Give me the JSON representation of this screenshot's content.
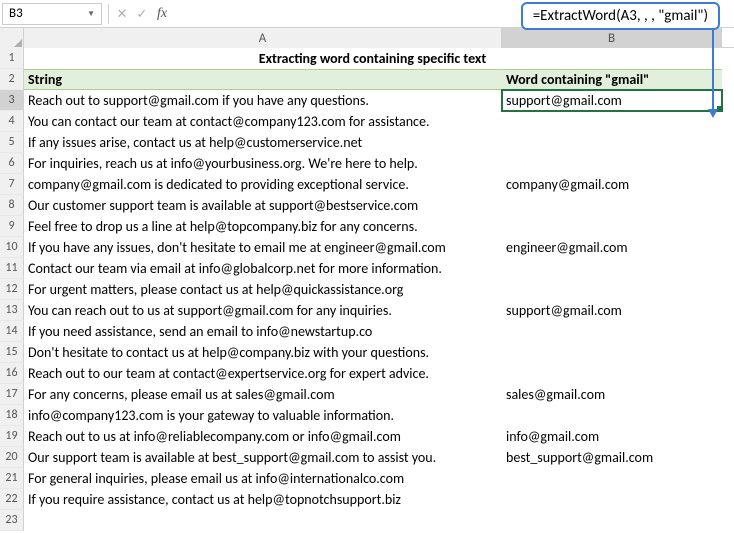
{
  "nameBox": {
    "value": "B3"
  },
  "formulaBar": {
    "cancelGlyph": "✕",
    "enterGlyph": "✓",
    "fxLabel": "fx",
    "value": ""
  },
  "callout": {
    "text": "=ExtractWord(A3, , , \"gmail\")"
  },
  "columns": {
    "A": "A",
    "B": "B"
  },
  "rowNumbers": [
    "1",
    "2",
    "3",
    "4",
    "5",
    "6",
    "7",
    "8",
    "9",
    "10",
    "11",
    "12",
    "13",
    "14",
    "15",
    "16",
    "17",
    "18",
    "19",
    "20",
    "21",
    "22",
    "23"
  ],
  "title": "Extracting word containing specific text",
  "headers": {
    "A": "String",
    "B": "Word containing \"gmail\""
  },
  "activeCell": "B3",
  "rows": [
    {
      "a": "Reach out to support@gmail.com if you have any questions.",
      "b": "support@gmail.com"
    },
    {
      "a": "You can contact our team at contact@company123.com for assistance.",
      "b": ""
    },
    {
      "a": "If any issues arise, contact us at help@customerservice.net",
      "b": ""
    },
    {
      "a": "For inquiries, reach us at info@yourbusiness.org. We're here to help.",
      "b": ""
    },
    {
      "a": "company@gmail.com is dedicated to providing exceptional service.",
      "b": "company@gmail.com"
    },
    {
      "a": "Our customer support team is available at support@bestservice.com",
      "b": ""
    },
    {
      "a": "Feel free to drop us a line at help@topcompany.biz for any concerns.",
      "b": ""
    },
    {
      "a": "If you have any issues, don't hesitate to email me at engineer@gmail.com",
      "b": "engineer@gmail.com"
    },
    {
      "a": "Contact our team via email at info@globalcorp.net for more information.",
      "b": ""
    },
    {
      "a": "For urgent matters, please contact us at help@quickassistance.org",
      "b": ""
    },
    {
      "a": "You can reach out to us at support@gmail.com for any inquiries.",
      "b": "support@gmail.com"
    },
    {
      "a": "If you need assistance, send an email to info@newstartup.co",
      "b": ""
    },
    {
      "a": "Don't hesitate to contact us at help@company.biz with your questions.",
      "b": ""
    },
    {
      "a": "Reach out to our team at contact@expertservice.org for expert advice.",
      "b": ""
    },
    {
      "a": "For any concerns, please email us at sales@gmail.com",
      "b": "sales@gmail.com"
    },
    {
      "a": "info@company123.com is your gateway to valuable information.",
      "b": ""
    },
    {
      "a": "Reach out to us at info@reliablecompany.com or info@gmail.com",
      "b": "info@gmail.com"
    },
    {
      "a": "Our support team is available at best_support@gmail.com to assist you.",
      "b": "best_support@gmail.com"
    },
    {
      "a": "For general inquiries, please email us at info@internationalco.com",
      "b": ""
    },
    {
      "a": "If you require assistance, contact us at help@topnotchsupport.biz",
      "b": ""
    },
    {
      "a": "",
      "b": ""
    }
  ]
}
